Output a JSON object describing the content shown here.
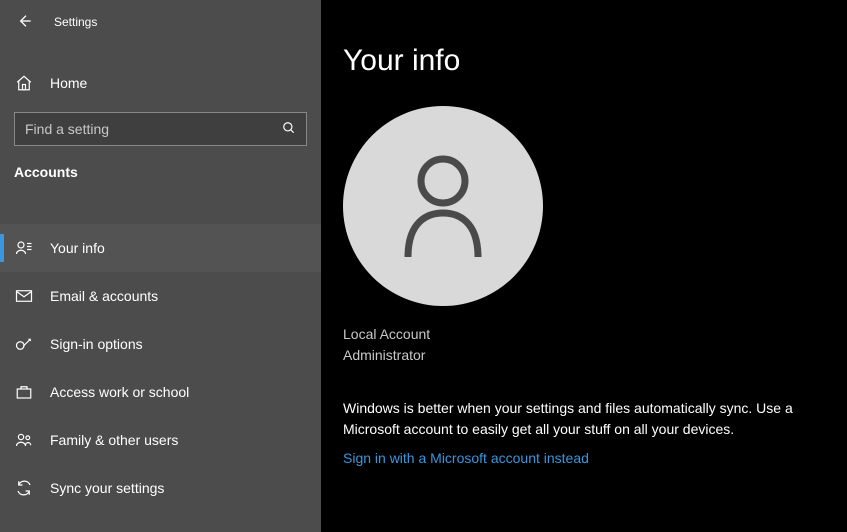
{
  "topbar": {
    "title": "Settings"
  },
  "home_label": "Home",
  "search": {
    "placeholder": "Find a setting"
  },
  "section_title": "Accounts",
  "nav": [
    {
      "label": "Your info",
      "active": true
    },
    {
      "label": "Email & accounts",
      "active": false
    },
    {
      "label": "Sign-in options",
      "active": false
    },
    {
      "label": "Access work or school",
      "active": false
    },
    {
      "label": "Family & other users",
      "active": false
    },
    {
      "label": "Sync your settings",
      "active": false
    }
  ],
  "main": {
    "title": "Your info",
    "account_type": "Local Account",
    "role": "Administrator",
    "sync_text": "Windows is better when your settings and files automatically sync. Use a Microsoft account to easily get all your stuff on all your devices.",
    "ms_link": "Sign in with a Microsoft account instead"
  }
}
